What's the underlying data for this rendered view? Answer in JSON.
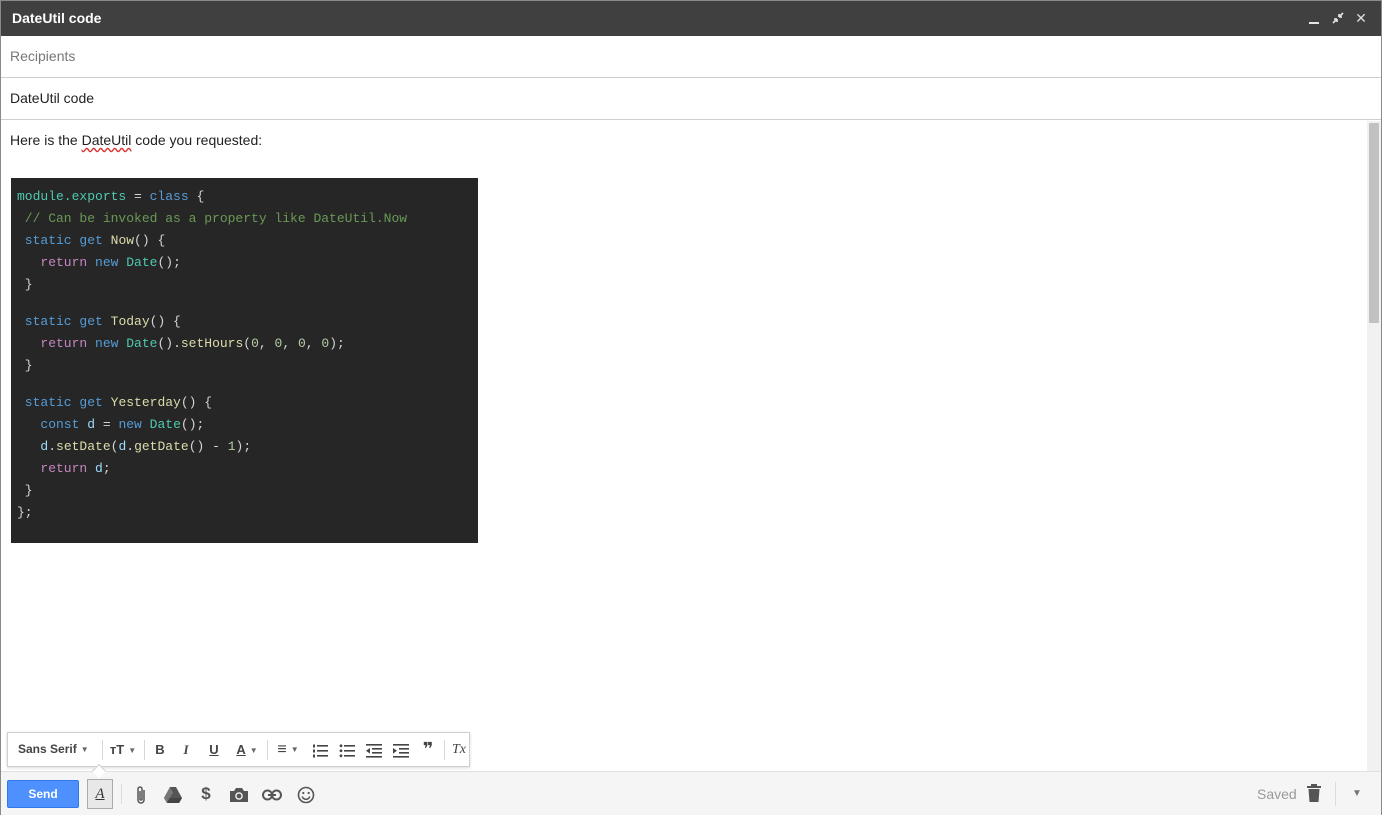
{
  "window": {
    "title": "DateUtil code",
    "minimize_glyph": "",
    "popout_glyph": "⤡",
    "close_glyph": "✕"
  },
  "recipients": {
    "placeholder": "Recipients",
    "value": ""
  },
  "subject": {
    "value": "DateUtil code"
  },
  "body": {
    "intro_before": "Here is the ",
    "intro_misspelled": "DateUtil",
    "intro_after": " code you requested:"
  },
  "code": [
    [
      [
        "mod",
        "module.exports"
      ],
      [
        "p",
        " = "
      ],
      [
        "kw",
        "class"
      ],
      [
        "p",
        " {"
      ]
    ],
    [
      [
        "cm",
        " // Can be invoked as a property like DateUtil.Now"
      ]
    ],
    [
      [
        "kw",
        " static"
      ],
      [
        "p",
        " "
      ],
      [
        "kw",
        "get"
      ],
      [
        "p",
        " "
      ],
      [
        "fn",
        "Now"
      ],
      [
        "p",
        "() {"
      ]
    ],
    [
      [
        "ret",
        "   return"
      ],
      [
        "p",
        " "
      ],
      [
        "kw",
        "new"
      ],
      [
        "p",
        " "
      ],
      [
        "mod",
        "Date"
      ],
      [
        "p",
        "();"
      ]
    ],
    [
      [
        "p",
        " }"
      ]
    ],
    [],
    [
      [
        "kw",
        " static"
      ],
      [
        "p",
        " "
      ],
      [
        "kw",
        "get"
      ],
      [
        "p",
        " "
      ],
      [
        "fn",
        "Today"
      ],
      [
        "p",
        "() {"
      ]
    ],
    [
      [
        "ret",
        "   return"
      ],
      [
        "p",
        " "
      ],
      [
        "kw",
        "new"
      ],
      [
        "p",
        " "
      ],
      [
        "mod",
        "Date"
      ],
      [
        "p",
        "()."
      ],
      [
        "fn",
        "setHours"
      ],
      [
        "p",
        "("
      ],
      [
        "num",
        "0"
      ],
      [
        "p",
        ", "
      ],
      [
        "num",
        "0"
      ],
      [
        "p",
        ", "
      ],
      [
        "num",
        "0"
      ],
      [
        "p",
        ", "
      ],
      [
        "num",
        "0"
      ],
      [
        "p",
        ");"
      ]
    ],
    [
      [
        "p",
        " }"
      ]
    ],
    [],
    [
      [
        "kw",
        " static"
      ],
      [
        "p",
        " "
      ],
      [
        "kw",
        "get"
      ],
      [
        "p",
        " "
      ],
      [
        "fn",
        "Yesterday"
      ],
      [
        "p",
        "() {"
      ]
    ],
    [
      [
        "kw",
        "   const"
      ],
      [
        "p",
        " "
      ],
      [
        "var",
        "d"
      ],
      [
        "p",
        " = "
      ],
      [
        "kw",
        "new"
      ],
      [
        "p",
        " "
      ],
      [
        "mod",
        "Date"
      ],
      [
        "p",
        "();"
      ]
    ],
    [
      [
        "var",
        "   d"
      ],
      [
        "p",
        "."
      ],
      [
        "fn",
        "setDate"
      ],
      [
        "p",
        "("
      ],
      [
        "var",
        "d"
      ],
      [
        "p",
        "."
      ],
      [
        "fn",
        "getDate"
      ],
      [
        "p",
        "() - "
      ],
      [
        "num",
        "1"
      ],
      [
        "p",
        ");"
      ]
    ],
    [
      [
        "ret",
        "   return"
      ],
      [
        "p",
        " "
      ],
      [
        "var",
        "d"
      ],
      [
        "p",
        ";"
      ]
    ],
    [
      [
        "p",
        " }"
      ]
    ],
    [
      [
        "p",
        "};"
      ]
    ]
  ],
  "format_toolbar": {
    "font_label": "Sans Serif",
    "size_glyph": "ᴛT",
    "bold": "B",
    "italic": "I",
    "underline": "U",
    "text_color": "A",
    "align": "≡",
    "numbered_list": "⒈",
    "bulleted_list": "☰",
    "indent_less": "⇤",
    "indent_more": "⇥",
    "quote": "❞",
    "clear_format": "Tx"
  },
  "bottom_bar": {
    "send_label": "Send",
    "format_toggle": "A",
    "saved_label": "Saved",
    "more_glyph": "▼"
  },
  "colors": {
    "send": "#4d90fe",
    "titlebar": "#404040",
    "code_bg": "#262626"
  }
}
